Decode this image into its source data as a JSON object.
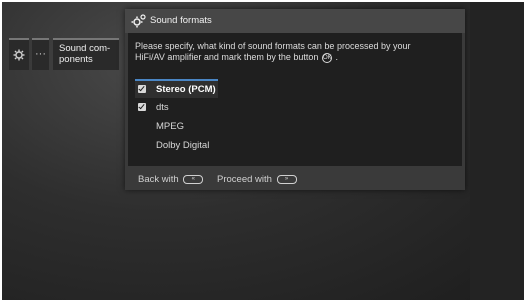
{
  "nav": {
    "gear_icon": "gear-icon",
    "dots_label": "···",
    "sound_label_line1": "Sound com-",
    "sound_label_line2": "ponents"
  },
  "dialog": {
    "title": "Sound formats",
    "instruction_line1": "Please specify, what kind of sound formats can be processed by your",
    "instruction_line2": "HiFi/AV amplifier and mark them by the button",
    "instruction_end": ".",
    "instruction_button_glyph": "OK",
    "options": [
      {
        "label": "Stereo (PCM)",
        "checked": true,
        "focused": true
      },
      {
        "label": "dts",
        "checked": true,
        "focused": false
      },
      {
        "label": "MPEG",
        "checked": false,
        "focused": false
      },
      {
        "label": "Dolby Digital",
        "checked": false,
        "focused": false
      }
    ],
    "footer": {
      "back_label": "Back with",
      "back_key": "«",
      "proceed_label": "Proceed with",
      "proceed_key": "»"
    }
  },
  "colors": {
    "accent": "#4a86c5",
    "dialog_bg": "#3a3a3a",
    "list_bg": "#1f1f1f"
  }
}
